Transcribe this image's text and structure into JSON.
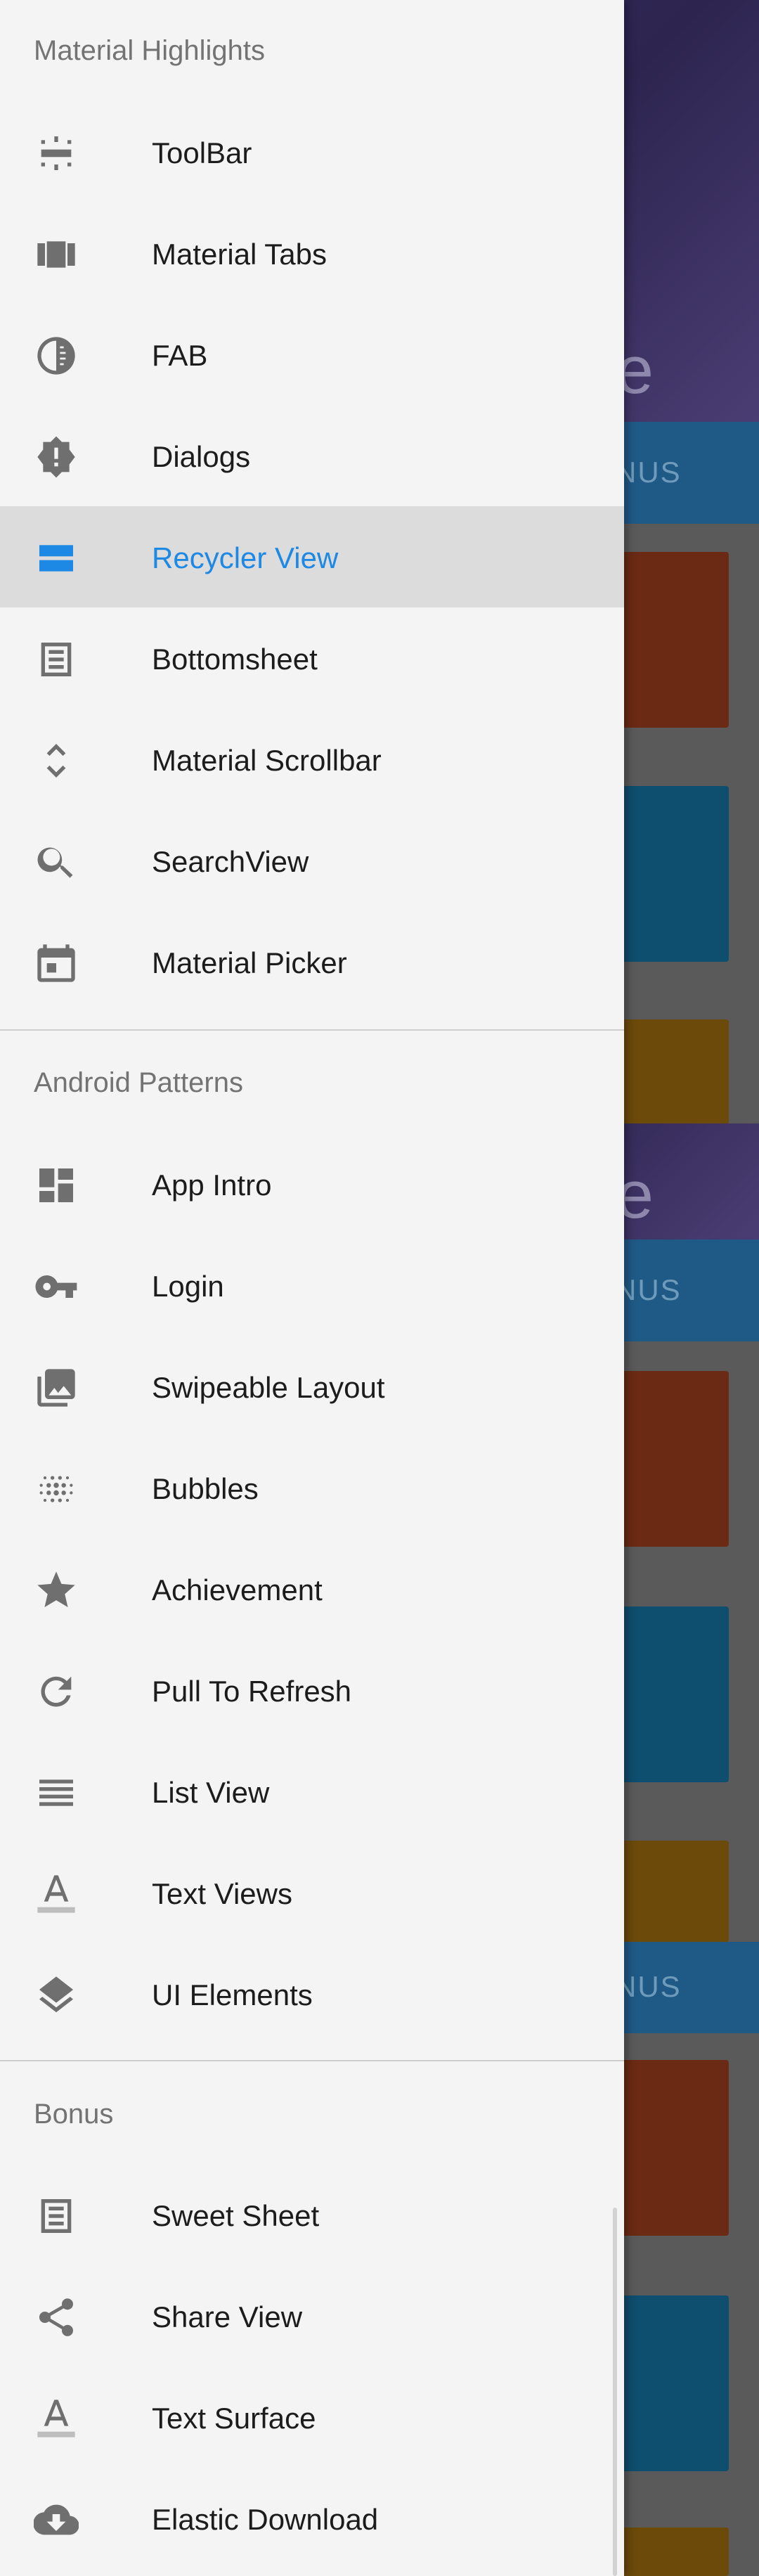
{
  "background": {
    "hero_text": "e",
    "tab_text": "NUS"
  },
  "drawer": {
    "sections": [
      {
        "header": "Material Highlights",
        "items": [
          {
            "label": "ToolBar",
            "icon": "toolbar-icon"
          },
          {
            "label": "Material Tabs",
            "icon": "tabs-icon"
          },
          {
            "label": "FAB",
            "icon": "fab-icon"
          },
          {
            "label": "Dialogs",
            "icon": "dialogs-icon"
          },
          {
            "label": "Recycler View",
            "icon": "recycler-view-icon",
            "active": true
          },
          {
            "label": "Bottomsheet",
            "icon": "bottomsheet-icon"
          },
          {
            "label": "Material Scrollbar",
            "icon": "scrollbar-icon"
          },
          {
            "label": "SearchView",
            "icon": "search-icon"
          },
          {
            "label": "Material Picker",
            "icon": "calendar-icon"
          }
        ]
      },
      {
        "header": "Android Patterns",
        "items": [
          {
            "label": "App Intro",
            "icon": "dashboard-icon"
          },
          {
            "label": "Login",
            "icon": "key-icon"
          },
          {
            "label": "Swipeable Layout",
            "icon": "photo-library-icon"
          },
          {
            "label": "Bubbles",
            "icon": "bubbles-icon"
          },
          {
            "label": "Achievement",
            "icon": "star-icon"
          },
          {
            "label": "Pull To Refresh",
            "icon": "refresh-icon"
          },
          {
            "label": "List View",
            "icon": "list-icon"
          },
          {
            "label": "Text Views",
            "icon": "text-format-icon"
          },
          {
            "label": "UI Elements",
            "icon": "layers-icon"
          }
        ]
      },
      {
        "header": "Bonus",
        "items": [
          {
            "label": "Sweet Sheet",
            "icon": "sheet-icon"
          },
          {
            "label": "Share View",
            "icon": "share-icon"
          },
          {
            "label": "Text Surface",
            "icon": "text-format-icon"
          },
          {
            "label": "Elastic Download",
            "icon": "cloud-download-icon"
          }
        ]
      }
    ]
  },
  "colors": {
    "accent": "#1e88e5",
    "drawer_bg": "#f4f4f4",
    "active_row_bg": "#dcdcdc",
    "icon_gray": "#6f6f6f"
  }
}
